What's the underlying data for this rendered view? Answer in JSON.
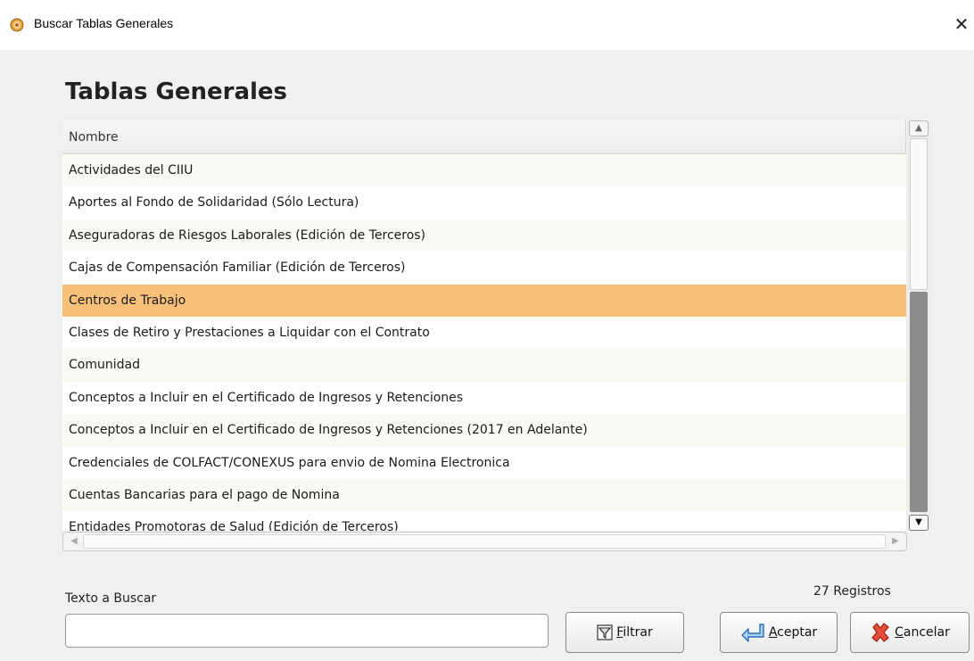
{
  "window": {
    "title": "Buscar Tablas Generales",
    "close_glyph": "✕",
    "icon": "app-globe-icon"
  },
  "heading": "Tablas Generales",
  "table": {
    "column_header": "Nombre",
    "rows": [
      "Actividades del CIIU",
      "Aportes al Fondo de Solidaridad (Sólo Lectura)",
      "Aseguradoras de Riesgos Laborales (Edición de Terceros)",
      "Cajas de Compensación Familiar (Edición de Terceros)",
      "Centros de Trabajo",
      "Clases de Retiro y Prestaciones a Liquidar con el Contrato",
      "Comunidad",
      "Conceptos a Incluir en el Certificado de Ingresos y Retenciones",
      "Conceptos a Incluir en el Certificado de Ingresos y Retenciones (2017 en Adelante)",
      "Credenciales de COLFACT/CONEXUS para envio de Nomina Electronica",
      "Cuentas Bancarias para el pago de Nomina",
      "Entidades Promotoras de Salud (Edición de Terceros)"
    ],
    "selected_row": "Centros de Trabajo",
    "selected_color": "#f9c07a"
  },
  "search": {
    "label": "Texto a Buscar",
    "value": "",
    "placeholder": ""
  },
  "records_label": "27 Registros",
  "buttons": {
    "filter": {
      "accel": "F",
      "rest": "iltrar",
      "icon": "filter-funnel-icon"
    },
    "accept": {
      "accel": "A",
      "rest": "ceptar",
      "icon": "enter-arrow-icon"
    },
    "cancel": {
      "accel": "C",
      "rest": "ancelar",
      "icon": "red-x-icon"
    }
  },
  "colors": {
    "accent_selected": "#f9c07a",
    "window_bg": "#f0f0f0",
    "cancel_icon": "#d93a2e",
    "accept_icon": "#3a7fd0"
  }
}
